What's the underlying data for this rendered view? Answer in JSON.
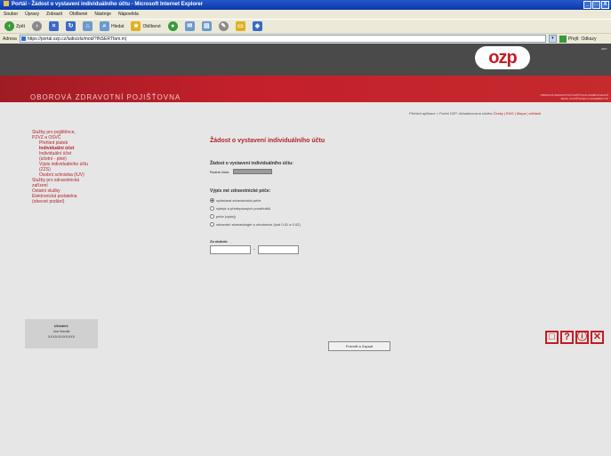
{
  "window": {
    "title": "Portál - Žádost o vystavení individuálního účtu - Microsoft Internet Explorer",
    "controls": [
      "_",
      "□",
      "X"
    ]
  },
  "menu": [
    "Soubor",
    "Úpravy",
    "Zobrazit",
    "Oblíbené",
    "Nástroje",
    "Nápověda"
  ],
  "toolbar": {
    "back_label": "Zpět",
    "search_label": "Hledat",
    "favorites_label": "Oblíbené"
  },
  "address": {
    "label": "Adresa",
    "url": "https://portal.ozp.cz/ludis/zls/mod/?INSERTfam.m)",
    "go_label": "Přejít",
    "links_label": "Odkazy"
  },
  "brand": {
    "org_name": "OBOROVÁ ZDRAVOTNÍ POJIŠŤOVNA",
    "logo_text": "ozp",
    "logo_subtitle": "OBOROVÁ ZDRAVOTNÍ POJIŠŤOVNA ZAMĚSTNANCŮ BANK, POJIŠŤOVEN A STAVEBNICTVÍ",
    "logo_year": "2007"
  },
  "breadcrumb": {
    "path": "Přehled aplikace > Portál OZP: Aktualizovaná služba",
    "links": "Česky | ENG | Mapa | odhlásit"
  },
  "sidebar": [
    {
      "label": "Služby pro pojištěnce,",
      "level": 0
    },
    {
      "label": "PZVZ a OSVČ",
      "level": 0
    },
    {
      "label": "Přehled plateb",
      "level": 1
    },
    {
      "label": "Individuální účet",
      "level": 1,
      "bold": true
    },
    {
      "label": "Individuální účet",
      "level": 1
    },
    {
      "label": "(účetní - plné)",
      "level": 1
    },
    {
      "label": "Výpis individuálního účtu",
      "level": 1
    },
    {
      "label": "(ZZS)",
      "level": 1
    },
    {
      "label": "Osobní schránka (IUV)",
      "level": 1
    },
    {
      "label": "Služby pro zdravotnická",
      "level": 0
    },
    {
      "label": "zařízení",
      "level": 0
    },
    {
      "label": "Ostatní služby",
      "level": 0
    },
    {
      "label": "Elektronická podatelna",
      "level": 0
    },
    {
      "label": "(obecné podání)",
      "level": 0
    }
  ],
  "user": {
    "role": "Uživatel:",
    "name": "Jan Novák",
    "id": "XXXX/XXXXXXX"
  },
  "form": {
    "title": "Žádost o vystavení individuálního účtu",
    "section_title": "Žádost o vystavení individuálního účtu:",
    "id_label": "Rodné číslo:",
    "id_value": "XXXXXXXXX",
    "types_title": "Výpis mé zdravotnické péče:",
    "options": [
      {
        "label": "vyžádaná zdravotnická péče",
        "selected": true
      },
      {
        "label": "výdeje a předepsaných prostředků",
        "selected": false
      },
      {
        "label": "péče (výdej)",
        "selected": false
      },
      {
        "label": "zdravotní stomatologie a ortodoncie (kód 0.01 a 0.02)",
        "selected": false
      }
    ],
    "period_label": "Za období:",
    "date_from": "",
    "date_to": "",
    "submit_label": "Potvrdit a Zapsat"
  },
  "actions": [
    "□",
    "?",
    "ⓘ",
    "✕"
  ]
}
